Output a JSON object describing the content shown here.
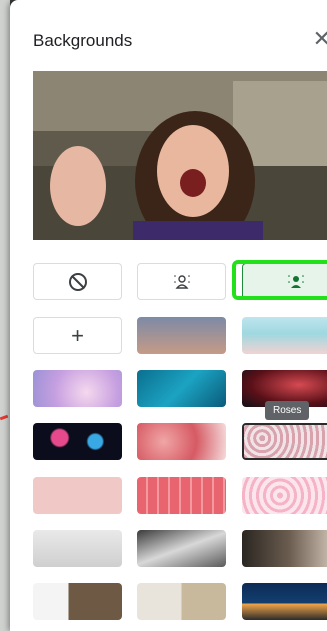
{
  "panel": {
    "title": "Backgrounds",
    "close_icon": "close-icon"
  },
  "effects": [
    {
      "name": "no-effect",
      "icon": "no-symbol-icon"
    },
    {
      "name": "slight-blur",
      "icon": "blur-person-icon"
    },
    {
      "name": "blur",
      "icon": "blur-person-icon",
      "selected": true
    }
  ],
  "add_background": {
    "icon": "plus-icon",
    "label": "+"
  },
  "tooltip": {
    "text": "Roses"
  },
  "backgrounds": [
    "sunset-gradient",
    "beach",
    "pink-clouds",
    "blue-water",
    "red-nebula",
    "fireworks",
    "pink-blossoms",
    "roses",
    "pink-bokeh",
    "pink-pattern",
    "petals",
    "white-office",
    "loft",
    "dark-room",
    "bookshelf",
    "bright-room",
    "night-house"
  ],
  "highlight_color": "#22e11a"
}
